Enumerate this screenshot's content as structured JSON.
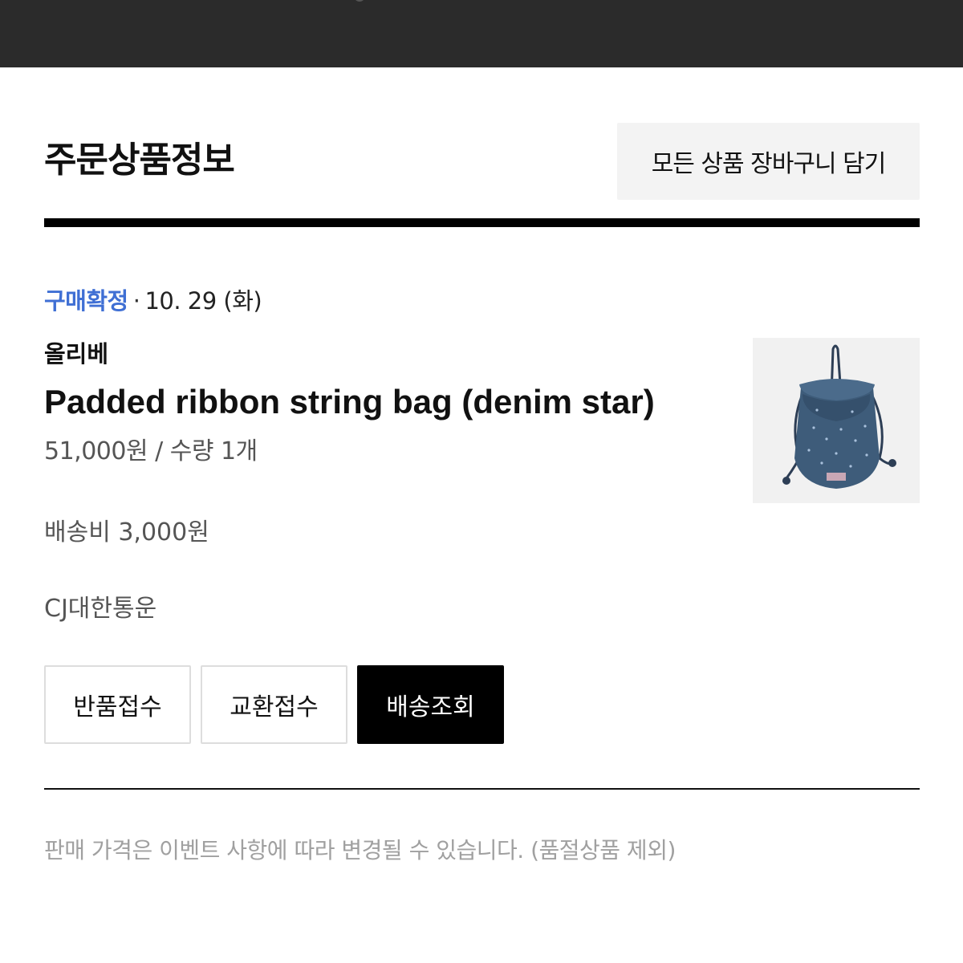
{
  "header": {
    "title": "주문상품정보",
    "add_all_to_cart_label": "모든 상품 장바구니 담기"
  },
  "order_item": {
    "status": "구매확정",
    "separator": "·",
    "date": "10. 29 (화)",
    "brand": "올리베",
    "product_name": "Padded ribbon string bag (denim star)",
    "price_quantity": "51,000원 / 수량 1개",
    "shipping_fee": "배송비 3,000원",
    "carrier": "CJ대한통운",
    "thumbnail_icon": "denim-drawstring-bag-image"
  },
  "actions": {
    "return_label": "반품접수",
    "exchange_label": "교환접수",
    "track_label": "배송조회"
  },
  "notice": "판매 가격은 이벤트 사항에 따라 변경될 수 있습니다. (품절상품 제외)",
  "colors": {
    "status_blue": "#3f6fd4",
    "primary_button": "#000000",
    "top_bar": "#2b2b2b"
  }
}
